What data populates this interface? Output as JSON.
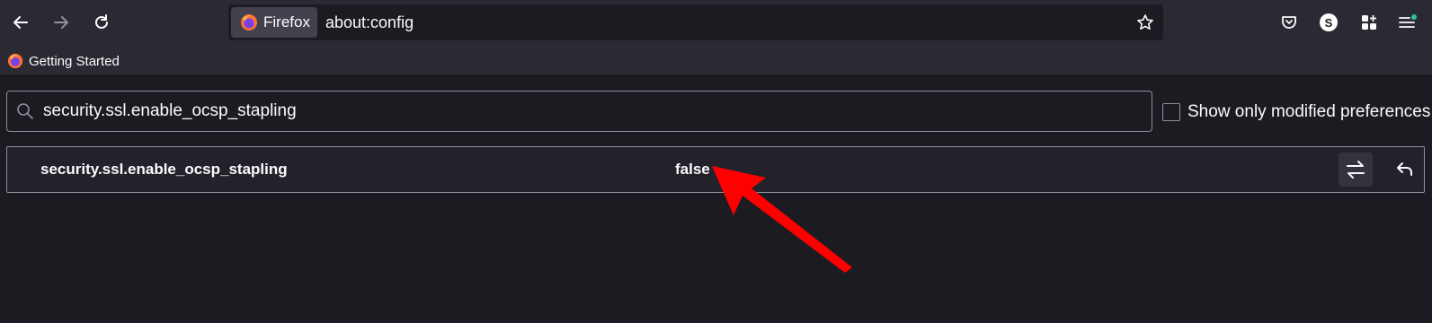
{
  "toolbar": {
    "back_icon": "arrow-left-icon",
    "forward_icon": "arrow-right-icon",
    "reload_icon": "reload-icon",
    "identity_label": "Firefox",
    "url": "about:config",
    "bookmark_star_icon": "star-icon",
    "pocket_icon": "pocket-icon",
    "account_initial": "S",
    "extensions_icon": "extensions-icon",
    "menu_icon": "hamburger-menu-icon"
  },
  "bookmarks": {
    "items": [
      {
        "label": "Getting Started",
        "icon": "firefox-logo-icon"
      }
    ]
  },
  "search": {
    "value": "security.ssl.enable_ocsp_stapling",
    "icon": "search-icon"
  },
  "filters": {
    "show_only_modified_label": "Show only modified preferences",
    "show_only_modified_checked": false
  },
  "preferences": [
    {
      "name": "security.ssl.enable_ocsp_stapling",
      "value": "false",
      "toggle_icon": "toggle-arrows-icon",
      "reset_icon": "undo-icon"
    }
  ],
  "colors": {
    "background": "#1c1b22",
    "toolbar": "#2b2a33",
    "annotation_arrow": "#ff0000",
    "accent": "#2ac3a2"
  }
}
